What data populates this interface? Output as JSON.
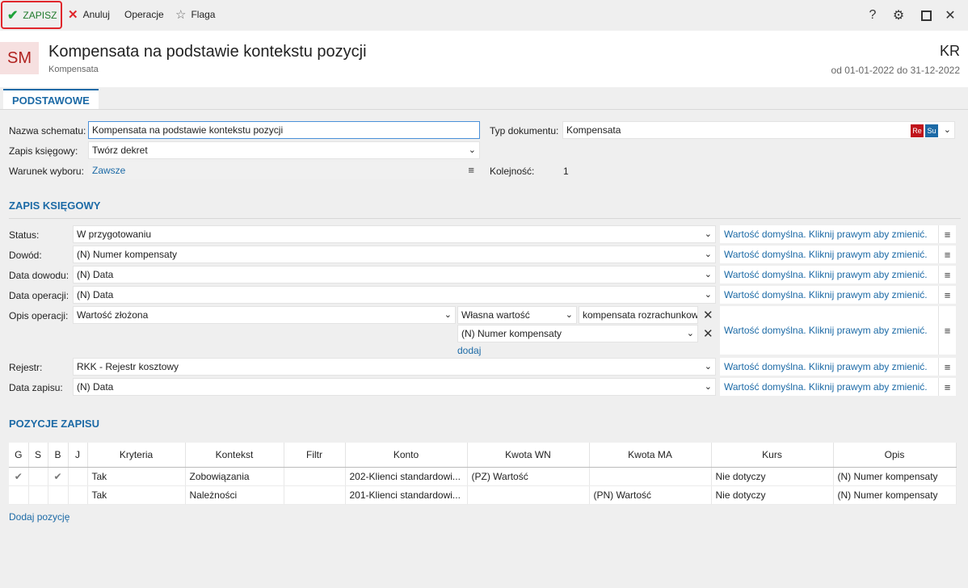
{
  "toolbar": {
    "save": "ZAPISZ",
    "cancel": "Anuluj",
    "operations": "Operacje",
    "flag": "Flaga",
    "right_icons": [
      "help-icon",
      "gear-icon",
      "maximize-icon",
      "close-icon"
    ]
  },
  "header": {
    "logo": "SM",
    "title": "Kompensata na podstawie kontekstu pozycji",
    "subtitle": "Kompensata",
    "code": "KR",
    "date_range": "od 01-01-2022 do 31-12-2022"
  },
  "tabs": [
    "PODSTAWOWE"
  ],
  "basic": {
    "scheme_name_label": "Nazwa schematu:",
    "scheme_name_value": "Kompensata na podstawie kontekstu pozycji",
    "doc_type_label": "Typ dokumentu:",
    "doc_type_value": "Kompensata",
    "badge_re": "Re",
    "badge_su": "Su",
    "posting_label": "Zapis księgowy:",
    "posting_value": "Twórz dekret",
    "condition_label": "Warunek wyboru:",
    "condition_value": "Zawsze",
    "order_label": "Kolejność:",
    "order_value": "1"
  },
  "posting_section": {
    "title": "ZAPIS KSIĘGOWY",
    "default_text": "Wartość domyślna. Kliknij prawym aby zmienić.",
    "status_label": "Status:",
    "status_value": "W przygotowaniu",
    "proof_label": "Dowód:",
    "proof_value": "(N) Numer kompensaty",
    "proof_date_label": "Data dowodu:",
    "proof_date_value": "(N) Data",
    "op_date_label": "Data operacji:",
    "op_date_value": "(N) Data",
    "op_desc_label": "Opis operacji:",
    "op_desc_value": "Wartość złożona",
    "op_desc_part1_type": "Własna wartość",
    "op_desc_part1_value": "kompensata rozrachunkow",
    "op_desc_part2_value": "(N) Numer kompensaty",
    "add_link": "dodaj",
    "register_label": "Rejestr:",
    "register_value": "RKK - Rejestr kosztowy",
    "entry_date_label": "Data zapisu:",
    "entry_date_value": "(N) Data"
  },
  "positions": {
    "title": "POZYCJE ZAPISU",
    "columns": [
      "G",
      "S",
      "B",
      "J",
      "Kryteria",
      "Kontekst",
      "Filtr",
      "Konto",
      "Kwota WN",
      "Kwota MA",
      "Kurs",
      "Opis"
    ],
    "rows": [
      {
        "g": "✔",
        "s": "",
        "b": "✔",
        "j": "",
        "kryteria": "Tak",
        "kontekst": "Zobowiązania",
        "filtr": "",
        "konto": "202-Klienci standardowi...",
        "kwota_wn": "(PZ) Wartość",
        "kwota_ma": "",
        "kurs": "Nie dotyczy",
        "opis": "(N) Numer kompensaty"
      },
      {
        "g": "",
        "s": "",
        "b": "",
        "j": "",
        "kryteria": "Tak",
        "kontekst": "Należności",
        "filtr": "",
        "konto": "201-Klienci standardowi...",
        "kwota_wn": "",
        "kwota_ma": "(PN) Wartość",
        "kurs": "Nie dotyczy",
        "opis": "(N) Numer kompensaty"
      }
    ],
    "add_link": "Dodaj pozycję"
  }
}
